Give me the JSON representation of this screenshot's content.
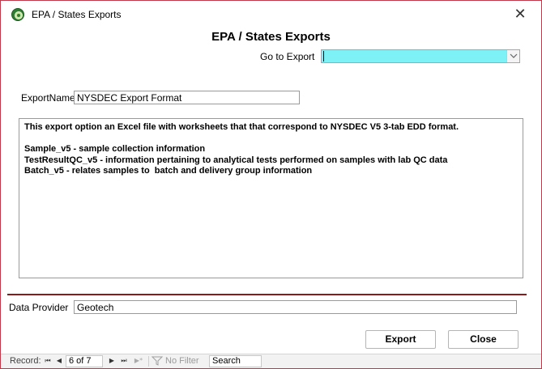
{
  "window": {
    "title": "EPA / States Exports",
    "close_glyph": "✕"
  },
  "form": {
    "heading": "EPA / States Exports",
    "goto_label": "Go to Export",
    "goto_value": "",
    "export_name_label": "ExportName",
    "export_name_value": "NYSDEC Export Format",
    "description": "This export option an Excel file with worksheets that that correspond to NYSDEC V5 3-tab EDD format.\n\nSample_v5 - sample collection information\nTestResultQC_v5 - information pertaining to analytical tests performed on samples with lab QC data\nBatch_v5 - relates samples to  batch and delivery group information",
    "data_provider_label": "Data Provider",
    "data_provider_value": "Geotech",
    "goto_bg_color": "#7ef1f7"
  },
  "buttons": {
    "export_label": "Export",
    "close_label": "Close"
  },
  "navigation": {
    "record_label": "Record:",
    "first_glyph": "⏮",
    "prev_glyph": "◀",
    "next_glyph": "▶",
    "last_glyph": "⏭",
    "new_glyph": "▶*",
    "position": "6 of 7",
    "filter_label": "No Filter",
    "search_label": "Search"
  },
  "icons": {
    "app": "access-form-icon",
    "close": "close-icon",
    "dropdown": "chevron-down-icon",
    "filter": "filter-icon"
  }
}
